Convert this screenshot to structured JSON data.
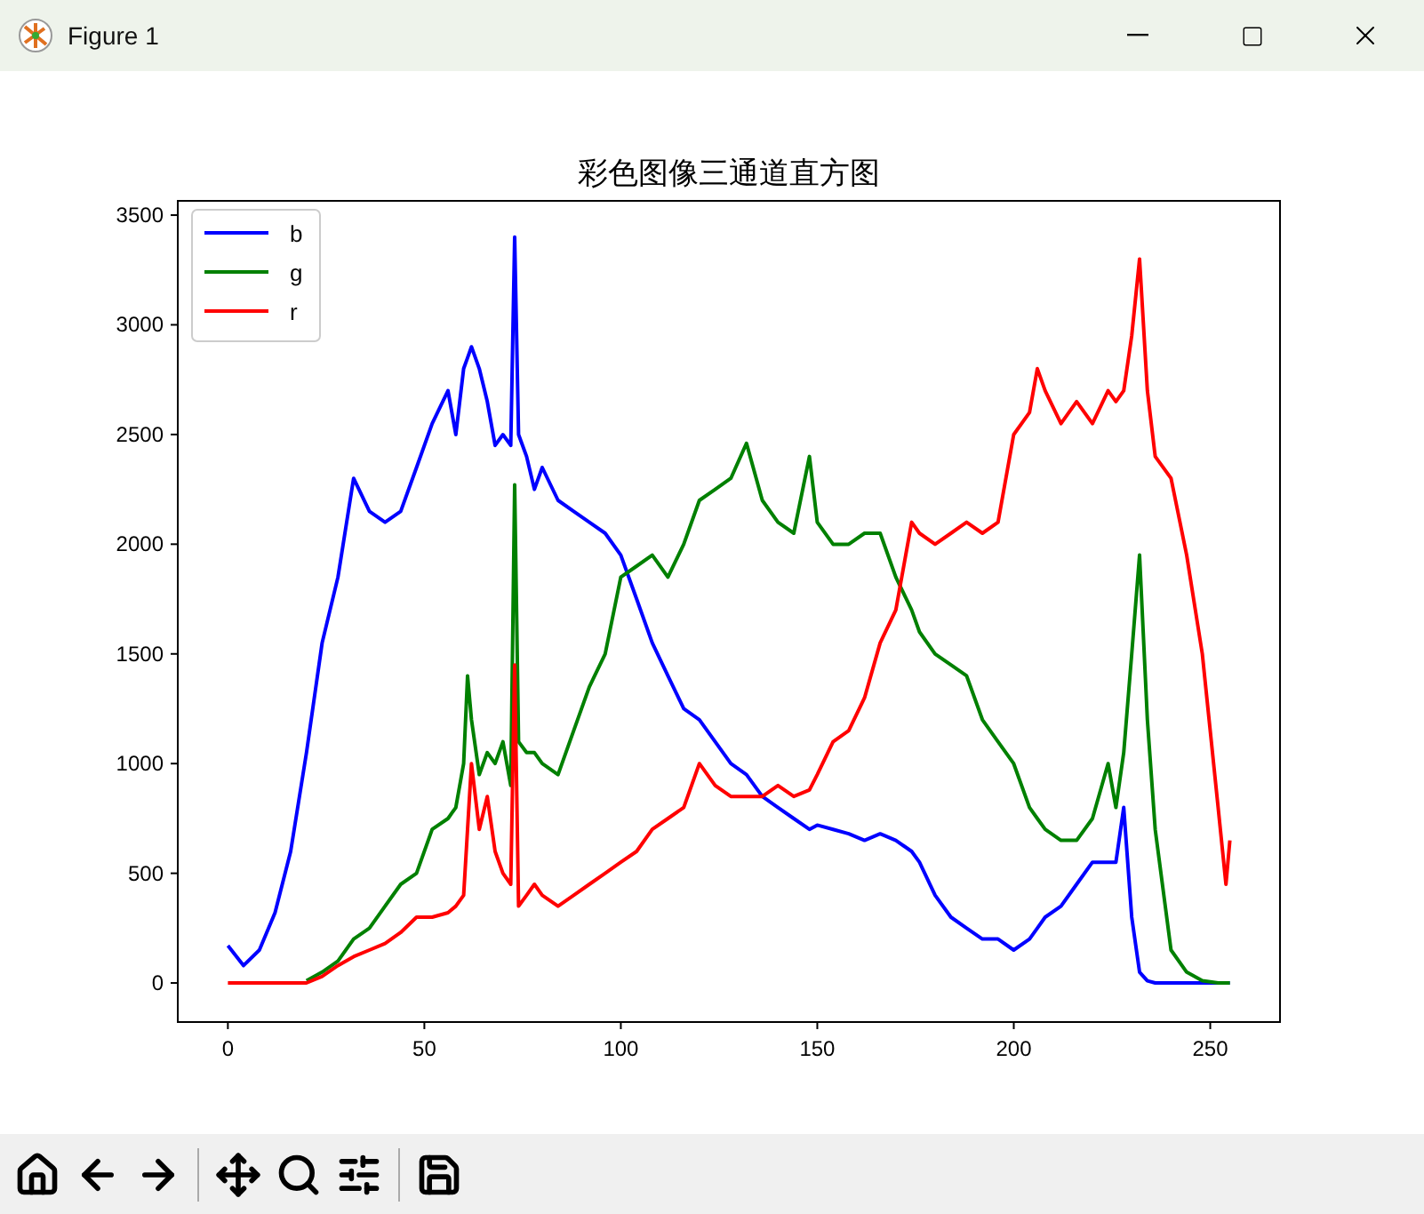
{
  "window": {
    "title": "Figure 1"
  },
  "figure": {
    "chart_data": {
      "type": "line",
      "title": "彩色图像三通道直方图",
      "x": [
        0,
        4,
        8,
        12,
        16,
        20,
        24,
        28,
        32,
        36,
        40,
        44,
        48,
        52,
        56,
        58,
        60,
        61,
        62,
        64,
        66,
        68,
        70,
        72,
        73,
        74,
        76,
        78,
        80,
        84,
        88,
        92,
        96,
        100,
        104,
        108,
        112,
        116,
        120,
        124,
        128,
        132,
        136,
        140,
        144,
        148,
        150,
        154,
        158,
        162,
        166,
        170,
        174,
        176,
        180,
        184,
        188,
        192,
        196,
        200,
        204,
        206,
        208,
        212,
        216,
        220,
        224,
        226,
        228,
        230,
        232,
        234,
        236,
        240,
        244,
        248,
        252,
        254,
        255
      ],
      "legend": true,
      "xlim": [
        -12.75,
        267.75
      ],
      "ylim": [
        -178,
        3565
      ],
      "xticks": [
        0,
        50,
        100,
        150,
        200,
        250
      ],
      "yticks": [
        0,
        500,
        1000,
        1500,
        2000,
        2500,
        3000,
        3500
      ],
      "series": [
        {
          "name": "b",
          "color": "#0000ff",
          "values": [
            170,
            80,
            150,
            320,
            600,
            1050,
            1550,
            1850,
            2300,
            2150,
            2100,
            2150,
            2350,
            2550,
            2700,
            2500,
            2800,
            2850,
            2900,
            2800,
            2650,
            2450,
            2500,
            2450,
            3400,
            2500,
            2400,
            2250,
            2350,
            2200,
            2150,
            2100,
            2050,
            1950,
            1750,
            1550,
            1400,
            1250,
            1200,
            1100,
            1000,
            950,
            850,
            800,
            750,
            700,
            720,
            700,
            680,
            650,
            680,
            650,
            600,
            550,
            400,
            300,
            250,
            200,
            200,
            150,
            200,
            250,
            300,
            350,
            450,
            550,
            550,
            550,
            800,
            300,
            50,
            10,
            0,
            0,
            0,
            0,
            0,
            0,
            0
          ]
        },
        {
          "name": "g",
          "color": "#008000",
          "values": [
            null,
            null,
            null,
            null,
            null,
            10,
            50,
            100,
            200,
            250,
            350,
            450,
            500,
            700,
            750,
            800,
            1000,
            1400,
            1200,
            950,
            1050,
            1000,
            1100,
            900,
            2270,
            1100,
            1050,
            1050,
            1000,
            950,
            1150,
            1350,
            1500,
            1850,
            1900,
            1950,
            1850,
            2000,
            2200,
            2250,
            2300,
            2460,
            2200,
            2100,
            2050,
            2400,
            2100,
            2000,
            2000,
            2050,
            2050,
            1850,
            1700,
            1600,
            1500,
            1450,
            1400,
            1200,
            1100,
            1000,
            800,
            750,
            700,
            650,
            650,
            750,
            1000,
            800,
            1050,
            1500,
            1950,
            1200,
            700,
            150,
            50,
            10,
            0,
            0,
            0
          ]
        },
        {
          "name": "r",
          "color": "#ff0000",
          "values": [
            0,
            0,
            0,
            0,
            0,
            0,
            30,
            80,
            120,
            150,
            180,
            230,
            300,
            300,
            320,
            350,
            400,
            700,
            1000,
            700,
            850,
            600,
            500,
            450,
            1450,
            350,
            400,
            450,
            400,
            350,
            400,
            450,
            500,
            550,
            600,
            700,
            750,
            800,
            1000,
            900,
            850,
            850,
            850,
            900,
            850,
            880,
            950,
            1100,
            1150,
            1300,
            1550,
            1700,
            2100,
            2050,
            2000,
            2050,
            2100,
            2050,
            2100,
            2500,
            2600,
            2800,
            2700,
            2550,
            2650,
            2550,
            2700,
            2650,
            2700,
            2950,
            3300,
            2700,
            2400,
            2300,
            1950,
            1500,
            800,
            450,
            650
          ]
        }
      ]
    }
  }
}
